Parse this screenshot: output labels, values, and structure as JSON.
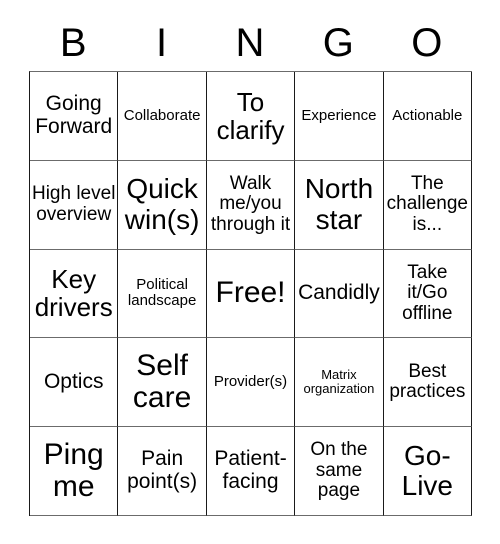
{
  "card": {
    "title": "BINGO",
    "header_letters": [
      "B",
      "I",
      "N",
      "G",
      "O"
    ],
    "rows": [
      [
        {
          "text": "Going Forward",
          "size": "md"
        },
        {
          "text": "Collaborate",
          "size": "xs"
        },
        {
          "text": "To clarify",
          "size": "lg"
        },
        {
          "text": "Experience",
          "size": "xs"
        },
        {
          "text": "Actionable",
          "size": "xs"
        }
      ],
      [
        {
          "text": "High level overview",
          "size": "sm"
        },
        {
          "text": "Quick win(s)",
          "size": "xl"
        },
        {
          "text": "Walk me/you through it",
          "size": "sm"
        },
        {
          "text": "North star",
          "size": "xl"
        },
        {
          "text": "The challenge is...",
          "size": "sm"
        }
      ],
      [
        {
          "text": "Key drivers",
          "size": "lg"
        },
        {
          "text": "Political landscape",
          "size": "xs"
        },
        {
          "text": "Free!",
          "size": "xxl"
        },
        {
          "text": "Candidly",
          "size": "md"
        },
        {
          "text": "Take it/Go offline",
          "size": "sm"
        }
      ],
      [
        {
          "text": "Optics",
          "size": "md"
        },
        {
          "text": "Self care",
          "size": "xxl"
        },
        {
          "text": "Provider(s)",
          "size": "xs"
        },
        {
          "text": "Matrix organization",
          "size": "xxs"
        },
        {
          "text": "Best practices",
          "size": "sm"
        }
      ],
      [
        {
          "text": "Ping me",
          "size": "xxl"
        },
        {
          "text": "Pain point(s)",
          "size": "md"
        },
        {
          "text": "Patient-facing",
          "size": "md"
        },
        {
          "text": "On the same page",
          "size": "sm"
        },
        {
          "text": "Go-Live",
          "size": "xl"
        }
      ]
    ]
  }
}
